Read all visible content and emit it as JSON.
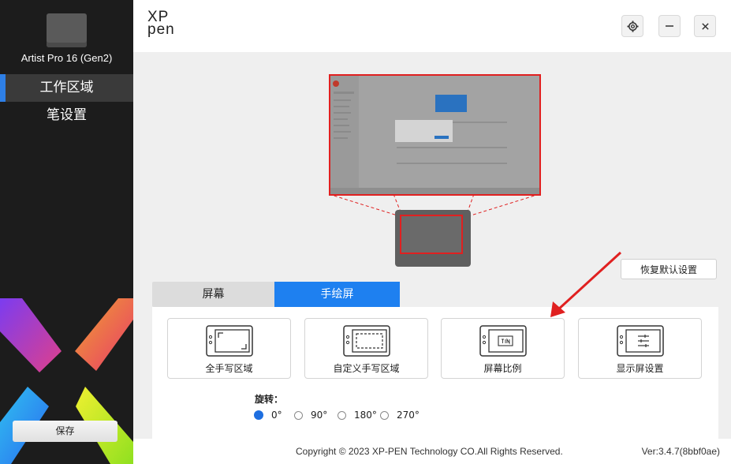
{
  "sidebar": {
    "device_name": "Artist Pro 16 (Gen2)",
    "nav": [
      {
        "label": "工作区域",
        "active": true
      },
      {
        "label": "笔设置",
        "active": false
      }
    ],
    "save_label": "保存"
  },
  "header": {
    "logo_line1": "XP",
    "logo_line2": "pen",
    "icons": [
      "gear-icon",
      "minimize-icon",
      "close-icon"
    ]
  },
  "main": {
    "reset_label": "恢复默认设置",
    "tabs": [
      {
        "label": "屏幕",
        "active": false
      },
      {
        "label": "手绘屏",
        "active": true
      }
    ],
    "cards": [
      {
        "label": "全手写区域",
        "icon": "full-area-icon"
      },
      {
        "label": "自定义手写区域",
        "icon": "custom-area-icon"
      },
      {
        "label": "屏幕比例",
        "icon": "screen-ratio-icon"
      },
      {
        "label": "显示屏设置",
        "icon": "display-settings-icon"
      }
    ],
    "rotation_label": "旋转：",
    "rotation_options": [
      {
        "label": "0°",
        "selected": true
      },
      {
        "label": "90°",
        "selected": false
      },
      {
        "label": "180°",
        "selected": false
      },
      {
        "label": "270°",
        "selected": false
      }
    ]
  },
  "footer": {
    "copyright": "Copyright © 2023  XP-PEN Technology CO.All Rights Reserved.",
    "version": "Ver:3.4.7(8bbf0ae)"
  },
  "colors": {
    "accent": "#1e80f0",
    "highlight_red": "#e02020",
    "sidebar_bg": "#1c1c1c"
  }
}
